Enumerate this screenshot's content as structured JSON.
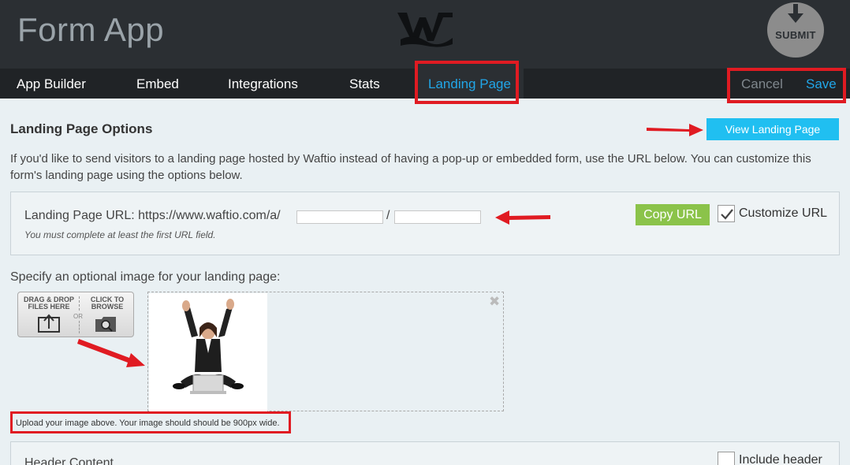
{
  "header": {
    "app_title": "Form App",
    "submit_badge": "SUBMIT"
  },
  "nav": {
    "tabs": [
      {
        "label": "App Builder"
      },
      {
        "label": "Embed"
      },
      {
        "label": "Integrations"
      },
      {
        "label": "Stats"
      },
      {
        "label": "Landing Page",
        "active": true
      }
    ],
    "cancel_label": "Cancel",
    "save_label": "Save"
  },
  "landing": {
    "title": "Landing Page Options",
    "view_button": "View Landing Page",
    "intro": "If you'd like to send visitors to a landing page hosted by Waftio instead of having a pop-up or embedded form, use the URL below. You can customize this form's landing page using the options below.",
    "url_label": "Landing Page URL: https://www.waftio.com/a/",
    "url_field_1": "",
    "url_separator": "/",
    "url_field_2": "",
    "url_note": "You must complete at least the first URL field.",
    "copy_button": "Copy URL",
    "customize_label": "Customize URL",
    "customize_checked": true
  },
  "image": {
    "prompt": "Specify an optional image for your landing page:",
    "drop_label": "DRAG & DROP FILES HERE",
    "or_label": "OR",
    "browse_label": "CLICK TO BROWSE",
    "upload_note": "Upload your image above. Your image should should be 900px wide."
  },
  "header_content": {
    "label": "Header Content",
    "include_label": "Include header",
    "include_checked": false
  },
  "colors": {
    "accent": "#21a6e8",
    "copy_green": "#8bc34a",
    "annotation_red": "#e01b22",
    "view_button": "#20bff1"
  }
}
